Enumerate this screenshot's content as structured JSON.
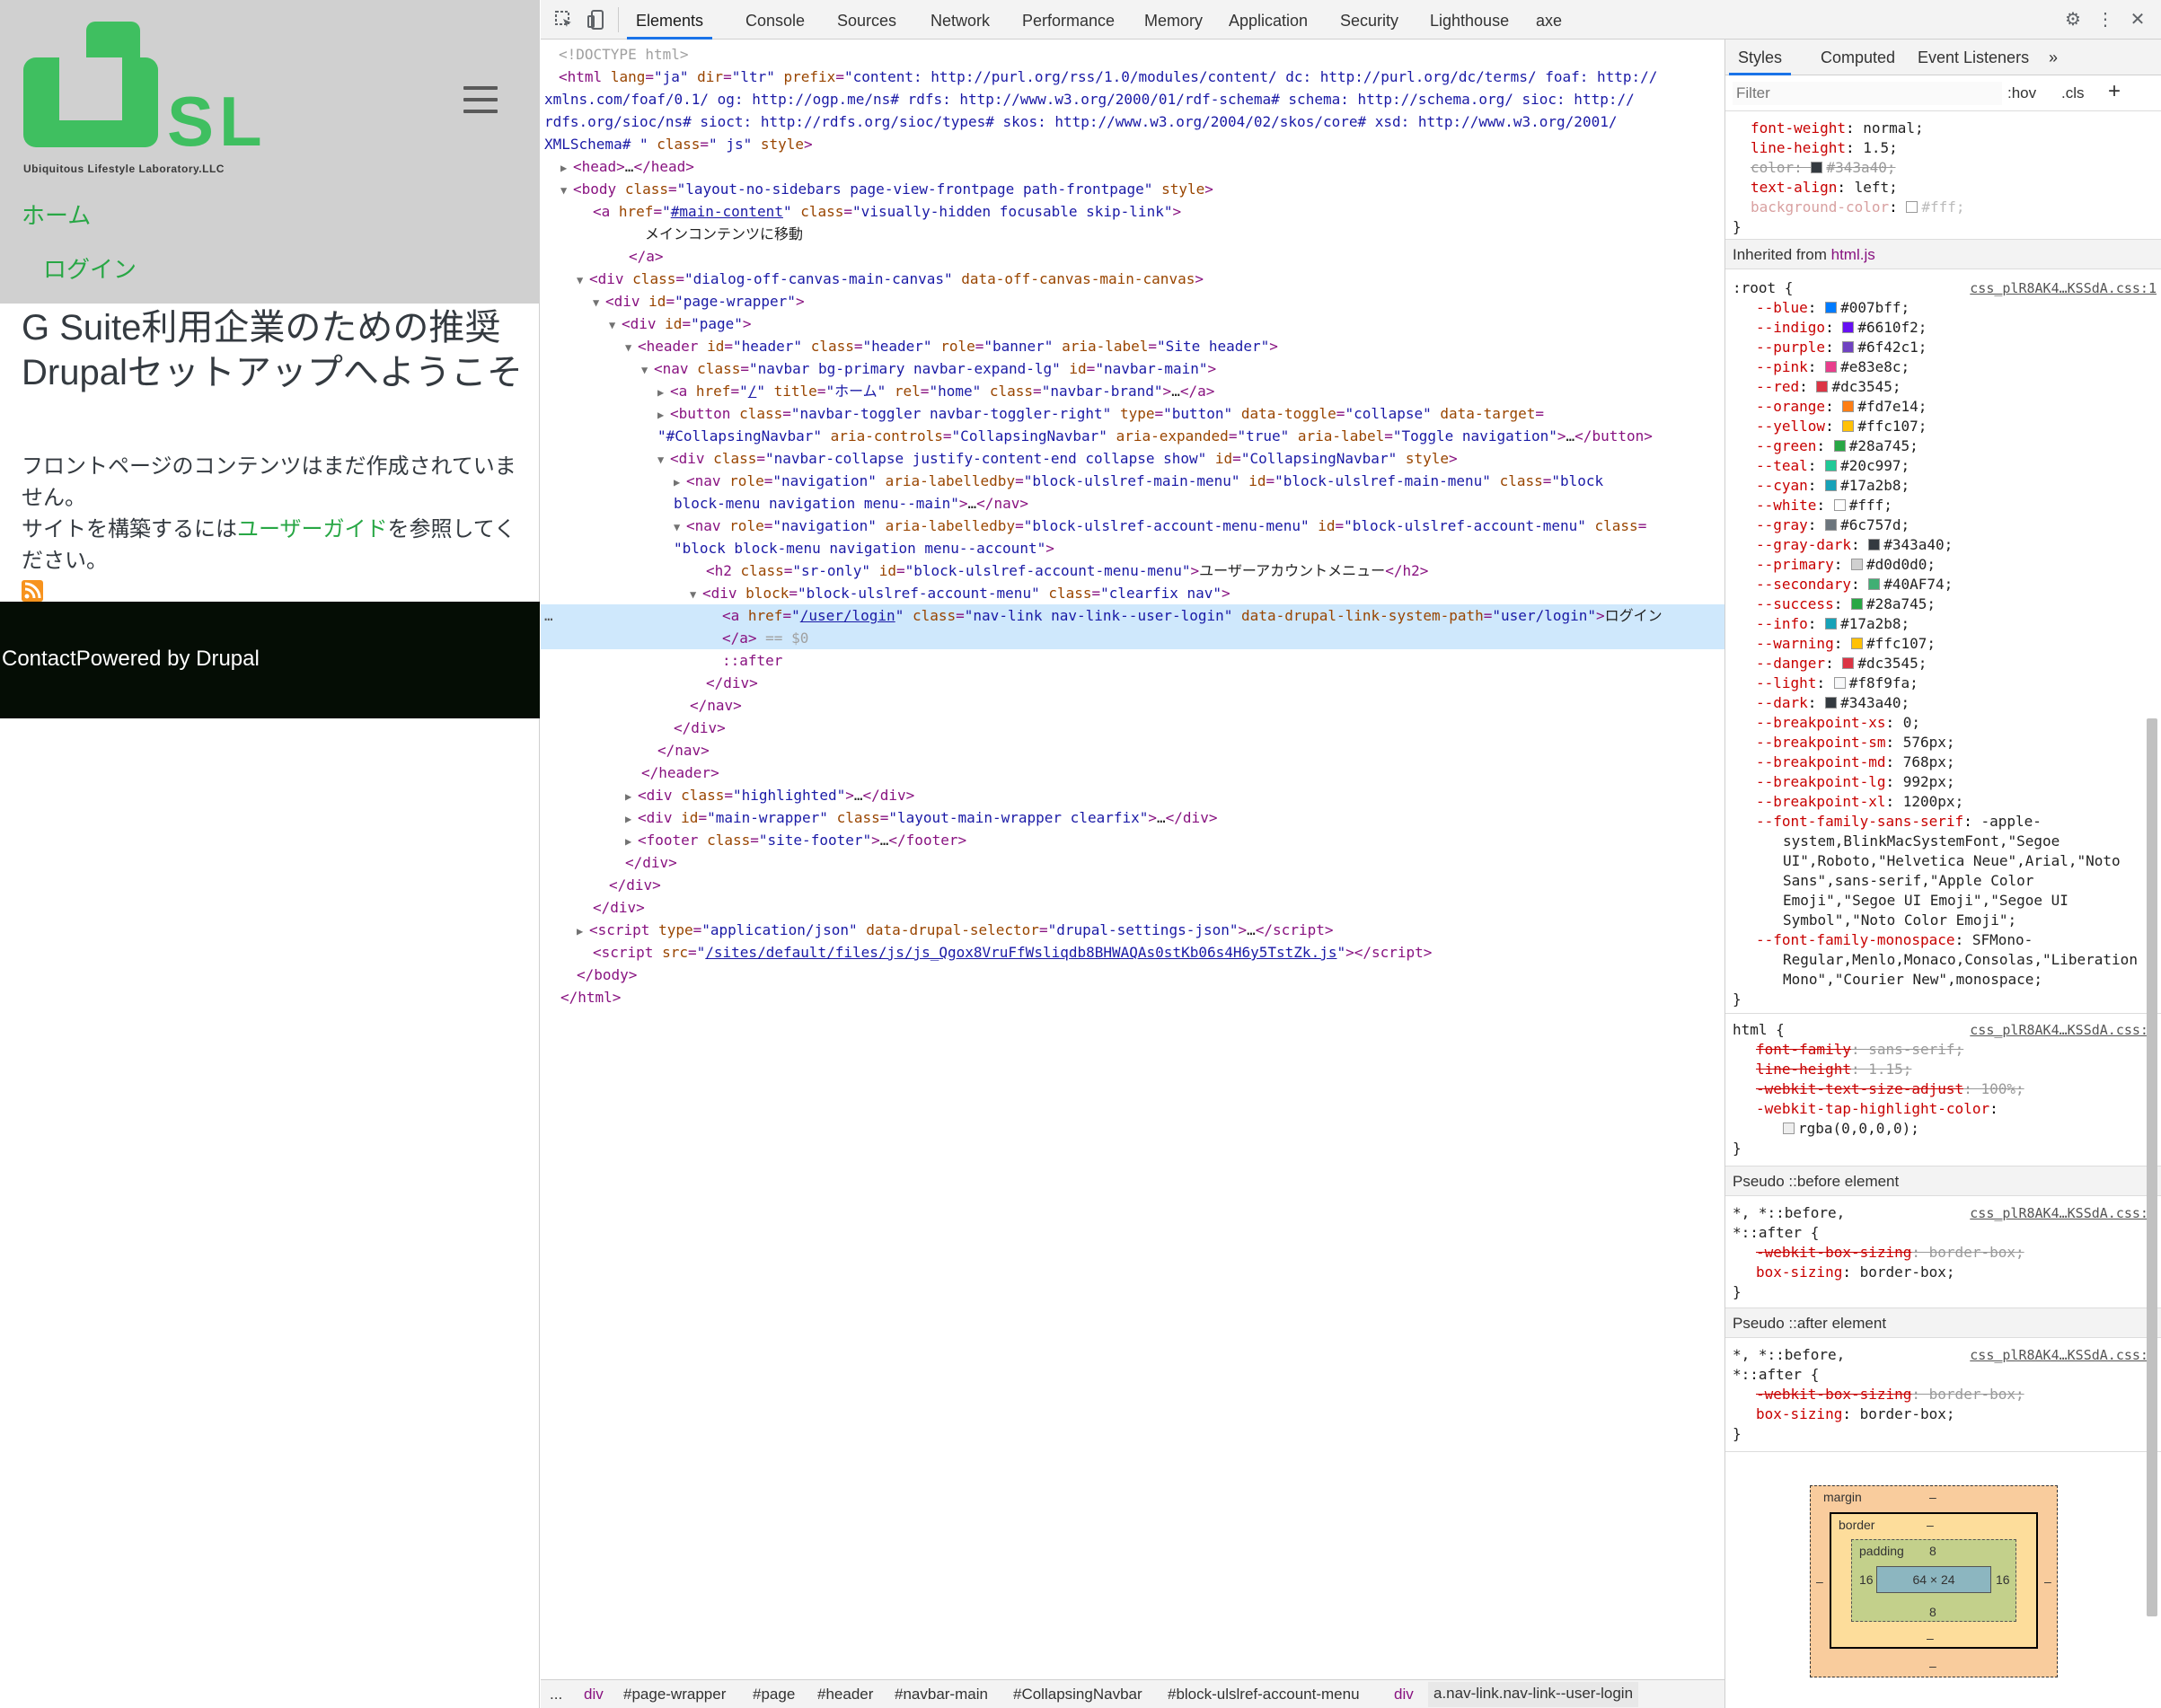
{
  "site": {
    "logo_letters": "ULSL",
    "logo_tagline": "Ubiquitous Lifestyle Laboratory.LLC",
    "nav_home": "ホーム",
    "nav_login": "ログイン",
    "title": "G Suite利用企業のための推奨Drupalセットアップへようこそ",
    "intro1": "フロントページのコンテンツはまだ作成されていません。",
    "intro2_pre": "サイトを構築するには",
    "intro2_link": "ユーザーガイド",
    "intro2_post": "を参照してください。",
    "footer": "ContactPowered by Drupal"
  },
  "devtools": {
    "tabs": [
      "Elements",
      "Console",
      "Sources",
      "Network",
      "Performance",
      "Memory",
      "Application",
      "Security",
      "Lighthouse",
      "axe"
    ],
    "active_tab": "Elements"
  },
  "elements": {
    "selected_suffix": "== $0"
  },
  "breadcrumb": [
    "...",
    "div",
    "#page-wrapper",
    "#page",
    "#header",
    "#navbar-main",
    "#CollapsingNavbar",
    "#block-ulslref-account-menu",
    "div",
    "a.nav-link.nav-link--user-login"
  ],
  "styles": {
    "tabs": [
      "Styles",
      "Computed",
      "Event Listeners"
    ],
    "filter_placeholder": "Filter",
    "hov": ":hov",
    "cls": ".cls",
    "inherited_from_label": "Inherited from",
    "inherited_from_value": "html.js",
    "source_file": "css_plR8AK4…KSSdA.css:1",
    "pseudo_before": "Pseudo ::before element",
    "pseudo_after": "Pseudo ::after element"
  },
  "box_model": {
    "margin_label": "margin",
    "margin": "–",
    "border_label": "border",
    "border": "–",
    "padding_label": "padding",
    "padding_top": "8",
    "padding_bottom": "8",
    "padding_left": "16",
    "padding_right": "16",
    "content": "64 × 24"
  },
  "colors": {
    "primary_green": "#28a745",
    "selection": "#cfe8fc",
    "tab_accent": "#1a73e8"
  }
}
